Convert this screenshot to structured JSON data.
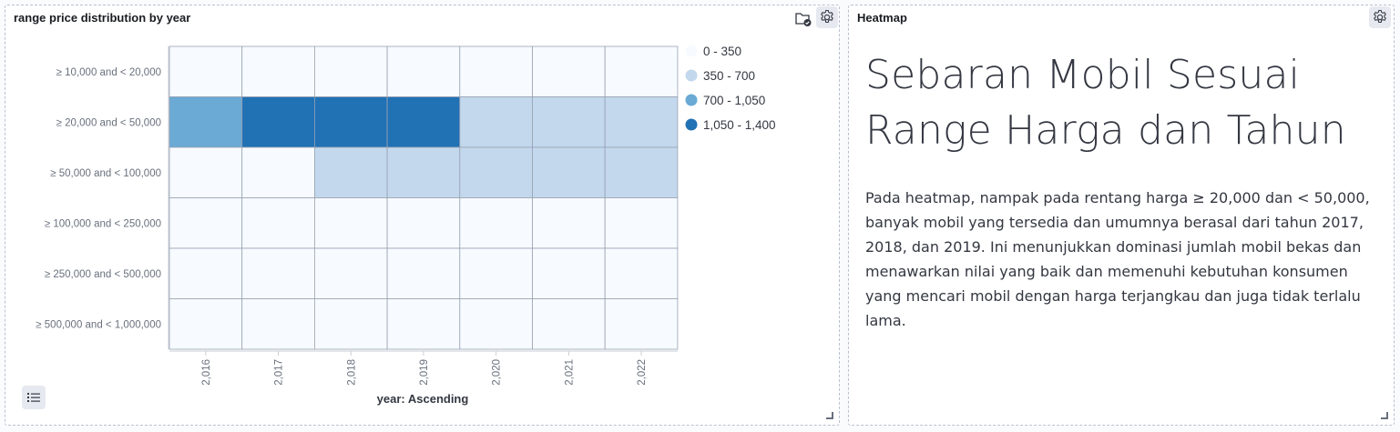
{
  "left_panel": {
    "title": "range price distribution by year",
    "icons": [
      "folder-check-icon",
      "gear-icon",
      "list-icon"
    ]
  },
  "right_panel": {
    "title": "Heatmap",
    "heading": "Sebaran Mobil Sesuai Range Harga dan Tahun",
    "body": "Pada heatmap, nampak pada rentang harga ≥ 20,000 dan < 50,000, banyak mobil yang tersedia dan umumnya berasal dari tahun 2017, 2018, dan 2019. Ini menunjukkan dominasi jumlah mobil bekas dan menawarkan nilai yang baik dan memenuhi kebutuhan konsumen yang mencari mobil dengan harga terjangkau dan juga tidak terlalu lama.",
    "icons": [
      "gear-icon"
    ]
  },
  "chart_data": {
    "type": "heatmap",
    "x_categories": [
      "2,016",
      "2,017",
      "2,018",
      "2,019",
      "2,020",
      "2,021",
      "2,022"
    ],
    "y_categories": [
      "≥ 10,000 and < 20,000",
      "≥ 20,000 and < 50,000",
      "≥ 50,000 and < 100,000",
      "≥ 100,000 and < 250,000",
      "≥ 250,000 and < 500,000",
      "≥ 500,000 and < 1,000,000"
    ],
    "xlabel": "year: Ascending",
    "legend": [
      {
        "label": "0 - 350",
        "color": "#f7fbff"
      },
      {
        "label": "350 - 700",
        "color": "#c3d8ec"
      },
      {
        "label": "700 - 1,050",
        "color": "#6aaad5"
      },
      {
        "label": "1,050 - 1,400",
        "color": "#2171b5"
      }
    ],
    "legend_position": "right",
    "cell_bins": [
      [
        0,
        0,
        0,
        0,
        0,
        0,
        0
      ],
      [
        2,
        3,
        3,
        3,
        1,
        1,
        1
      ],
      [
        0,
        0,
        1,
        1,
        1,
        1,
        1
      ],
      [
        0,
        0,
        0,
        0,
        0,
        0,
        0
      ],
      [
        0,
        0,
        0,
        0,
        0,
        0,
        0
      ],
      [
        0,
        0,
        0,
        0,
        0,
        0,
        0
      ]
    ]
  }
}
